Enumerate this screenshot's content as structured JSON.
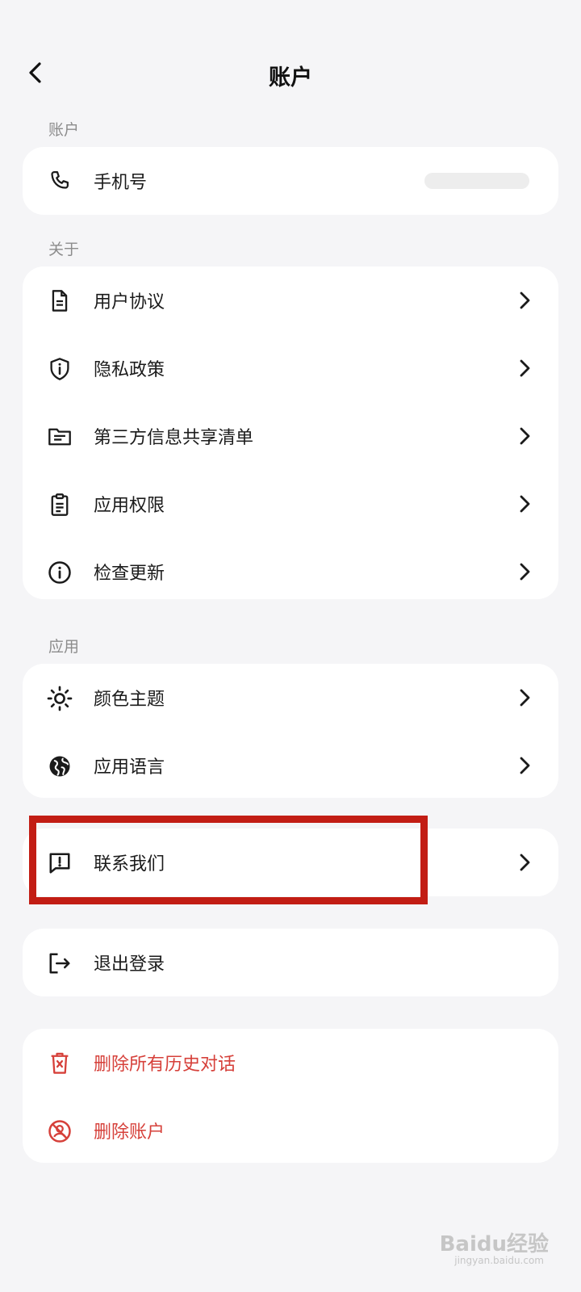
{
  "header": {
    "title": "账户",
    "back_icon": "chevron-left-icon"
  },
  "sections": {
    "account": "账户",
    "about": "关于",
    "app": "应用"
  },
  "account_card": {
    "phone": {
      "label": "手机号",
      "icon": "phone-icon",
      "value": ""
    }
  },
  "about_card": {
    "items": [
      {
        "label": "用户协议",
        "icon": "document-icon"
      },
      {
        "label": "隐私政策",
        "icon": "shield-info-icon"
      },
      {
        "label": "第三方信息共享清单",
        "icon": "folder-list-icon"
      },
      {
        "label": "应用权限",
        "icon": "clipboard-icon"
      },
      {
        "label": "检查更新",
        "icon": "info-circle-icon"
      }
    ]
  },
  "app_card": {
    "items": [
      {
        "label": "颜色主题",
        "icon": "sun-icon"
      },
      {
        "label": "应用语言",
        "icon": "globe-icon"
      }
    ]
  },
  "contact": {
    "label": "联系我们",
    "icon": "feedback-icon"
  },
  "logout": {
    "label": "退出登录",
    "icon": "logout-icon"
  },
  "danger_card": {
    "items": [
      {
        "label": "删除所有历史对话",
        "icon": "trash-icon"
      },
      {
        "label": "删除账户",
        "icon": "delete-account-icon"
      }
    ]
  },
  "colors": {
    "danger": "#d6403a",
    "highlight": "#c21d14",
    "background": "#f5f5f7"
  },
  "watermark": {
    "text": "Baidu经验",
    "sub": "jingyan.baidu.com"
  }
}
